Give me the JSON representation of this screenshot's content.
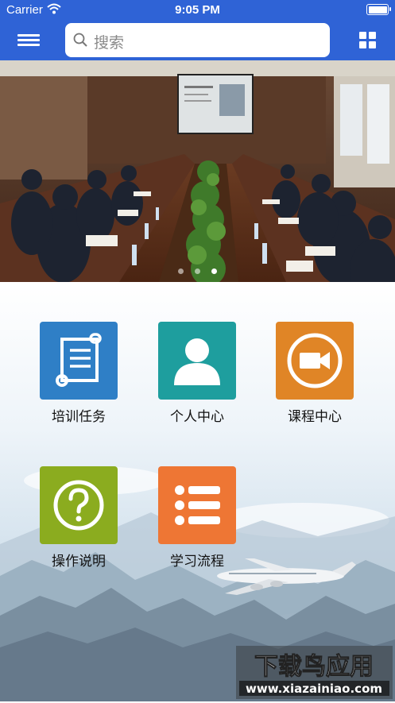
{
  "status_bar": {
    "carrier": "Carrier",
    "time": "9:05 PM"
  },
  "search": {
    "placeholder": "搜索"
  },
  "banner": {
    "slide_count": 3,
    "active_slide": 3
  },
  "menu": [
    {
      "label": "培训任务",
      "icon": "scroll-document-icon",
      "color": "#2f7fc6"
    },
    {
      "label": "个人中心",
      "icon": "user-icon",
      "color": "#1e9e9e"
    },
    {
      "label": "课程中心",
      "icon": "video-camera-icon",
      "color": "#e08526"
    },
    {
      "label": "操作说明",
      "icon": "question-icon",
      "color": "#8bac1f"
    },
    {
      "label": "学习流程",
      "icon": "list-icon",
      "color": "#ee7634"
    }
  ],
  "watermark": {
    "title": "下载鸟应用",
    "url": "www.xiazainiao.com"
  },
  "colors": {
    "nav": "#2f63d6"
  }
}
